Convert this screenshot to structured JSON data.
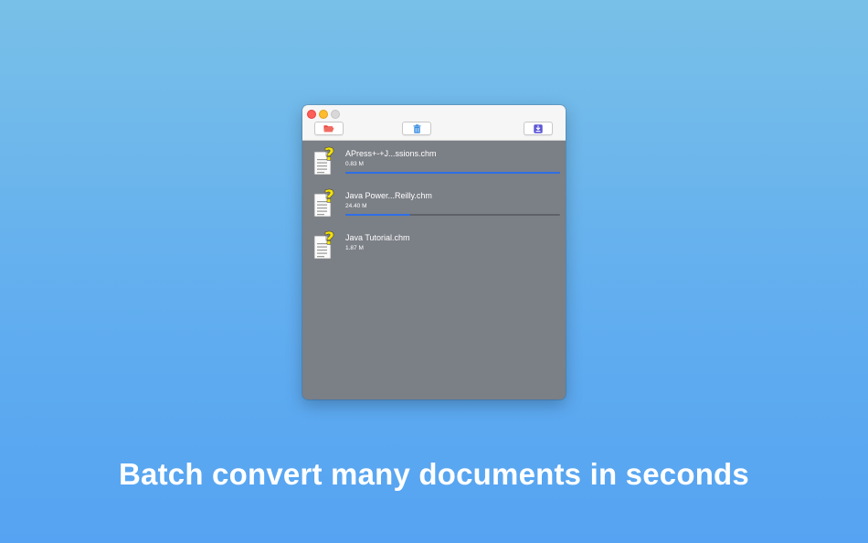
{
  "toolbar": {
    "open_icon": "folder-open-icon",
    "delete_icon": "trash-icon",
    "convert_icon": "convert-download-icon"
  },
  "files": [
    {
      "name": "APress+-+J...ssions.chm",
      "size": "0.83 M",
      "progress": 1.0
    },
    {
      "name": "Java Power...Reilly.chm",
      "size": "24.40 M",
      "progress": 0.3
    },
    {
      "name": "Java Tutorial.chm",
      "size": "1.87 M",
      "progress": null
    }
  ],
  "caption": "Batch convert many documents in seconds",
  "colors": {
    "accent": "#2f6ee6",
    "list_background": "#7b7f86",
    "open_icon": "#e8453c",
    "delete_icon": "#3a8de0",
    "convert_icon": "#5b55d6"
  }
}
